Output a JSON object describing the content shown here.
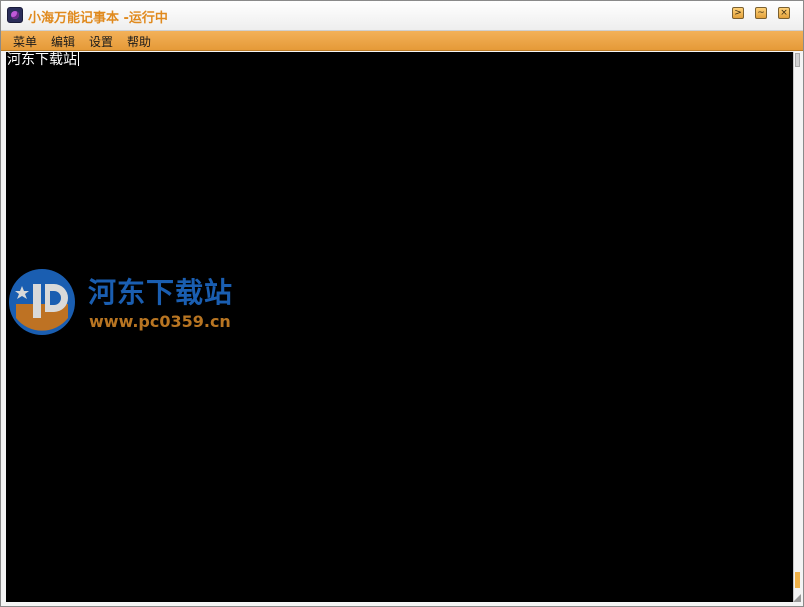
{
  "window": {
    "title": "小海万能记事本 -运行中"
  },
  "title_buttons": {
    "minimize_glyph": ">",
    "restore_glyph": "~",
    "close_glyph": "×"
  },
  "menu": {
    "items": [
      {
        "label": "菜单"
      },
      {
        "label": "编辑"
      },
      {
        "label": "设置"
      },
      {
        "label": "帮助"
      }
    ]
  },
  "editor": {
    "content": "河东下载站"
  },
  "watermark": {
    "site_name": "河东下载站",
    "url": "www.pc0359.cn"
  },
  "colors": {
    "title_text": "#e08a1e",
    "menubar": "#eea447",
    "editor_bg": "#000000",
    "editor_text": "#ffffff",
    "watermark_blue": "#1f6fd1",
    "watermark_orange": "#d98a28"
  },
  "icons": {
    "app": "notepad-app-icon",
    "minimize": "minimize-icon",
    "restore": "restore-icon",
    "close": "close-icon"
  }
}
